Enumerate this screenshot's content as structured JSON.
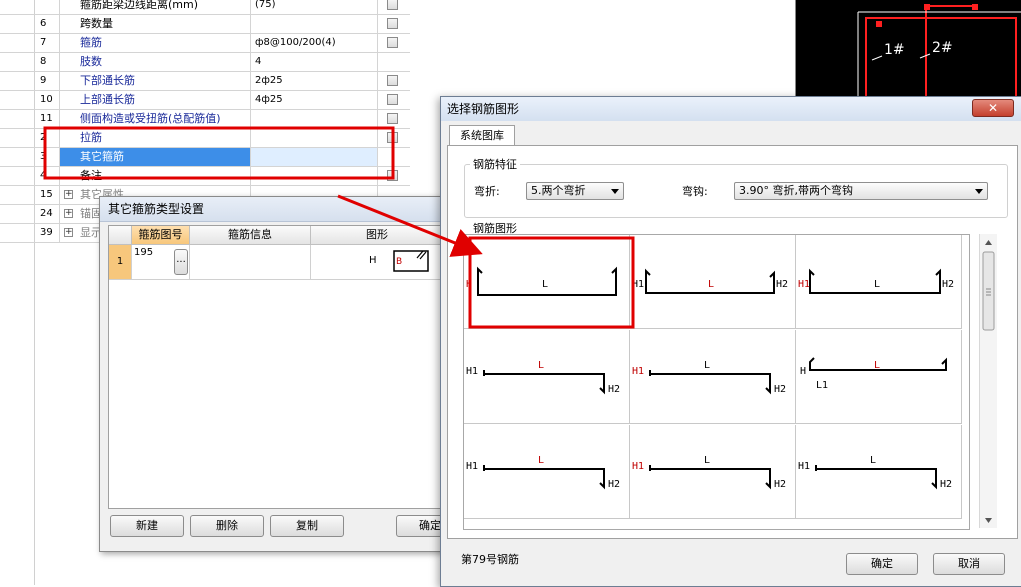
{
  "prop_table": {
    "rows": [
      {
        "idx": "",
        "name": "箍筋距梁边线距离(mm)",
        "value": "(75)",
        "checkbox": true,
        "color": "black"
      },
      {
        "idx": "6",
        "name": "跨数量",
        "value": "",
        "checkbox": true,
        "color": "black"
      },
      {
        "idx": "7",
        "name": "箍筋",
        "value": "ф8@100/200(4)",
        "checkbox": true,
        "color": "blue"
      },
      {
        "idx": "8",
        "name": "肢数",
        "value": "4",
        "checkbox": false,
        "color": "blue"
      },
      {
        "idx": "9",
        "name": "下部通长筋",
        "value": "2ф25",
        "checkbox": true,
        "color": "blue"
      },
      {
        "idx": "10",
        "name": "上部通长筋",
        "value": "4ф25",
        "checkbox": true,
        "color": "blue"
      },
      {
        "idx": "11",
        "name": "侧面构造或受扭筋(总配筋值)",
        "value": "",
        "checkbox": true,
        "color": "blue"
      },
      {
        "idx": "2",
        "name": "拉筋",
        "value": "",
        "checkbox": true,
        "color": "blue"
      },
      {
        "idx": "3",
        "name": "其它箍筋",
        "value": "",
        "checkbox": false,
        "color": "blue",
        "selected": true
      },
      {
        "idx": "4",
        "name": "备注",
        "value": "",
        "checkbox": true,
        "color": "black"
      },
      {
        "idx": "15",
        "name": "其它属性",
        "value": "",
        "checkbox": false,
        "color": "gray",
        "expand": true
      },
      {
        "idx": "24",
        "name": "锚固",
        "value": "",
        "checkbox": false,
        "color": "gray",
        "expand": true
      },
      {
        "idx": "39",
        "name": "显示",
        "value": "",
        "checkbox": false,
        "color": "gray",
        "expand": true
      }
    ]
  },
  "cad": {
    "labels": [
      "1#",
      "2#"
    ]
  },
  "stirrup_dialog": {
    "title": "其它箍筋类型设置",
    "headers": {
      "col1": "箍筋图号",
      "col2": "箍筋信息",
      "col3": "图形"
    },
    "row": {
      "num": "1",
      "code": "195",
      "dots": "...",
      "shape_h": "H",
      "shape_b": "B"
    },
    "buttons": {
      "new": "新建",
      "delete": "删除",
      "copy": "复制",
      "ok": "确定"
    }
  },
  "shape_dialog": {
    "title": "选择钢筋图形",
    "close": "✕",
    "tab": "系统图库",
    "feature_group": "钢筋特征",
    "bend_label": "弯折:",
    "bend_value": "5.两个弯折",
    "hook_label": "弯钩:",
    "hook_value": "3.90° 弯折,带两个弯钩",
    "shape_group": "钢筋图形",
    "status": "第79号钢筋",
    "ok": "确定",
    "cancel": "取消"
  },
  "shapes": [
    {
      "l": "L",
      "a": "H",
      "b": "",
      "lred": false,
      "ared": true
    },
    {
      "l": "L",
      "a": "H1",
      "b": "H2",
      "lred": true,
      "ared": false
    },
    {
      "l": "L",
      "a": "H1",
      "b": "H2",
      "lred": false,
      "ared": true
    },
    {
      "l": "L",
      "a": "H1",
      "b": "H2",
      "lred": true,
      "ared": false
    },
    {
      "l": "L",
      "a": "H1",
      "b": "H2",
      "lred": false,
      "ared": true
    },
    {
      "l": "L",
      "a": "H",
      "b": "L1",
      "lred": true,
      "ared": false
    },
    {
      "l": "L",
      "a": "H1",
      "b": "H2",
      "lred": true,
      "ared": false
    },
    {
      "l": "L",
      "a": "H1",
      "b": "H2",
      "lred": false,
      "ared": true
    },
    {
      "l": "L",
      "a": "H1",
      "b": "H2",
      "lred": false,
      "ared": false
    }
  ],
  "colors": {
    "highlight": "#e00000",
    "accent": "#3d8ee8",
    "text_red": "#c00000"
  }
}
